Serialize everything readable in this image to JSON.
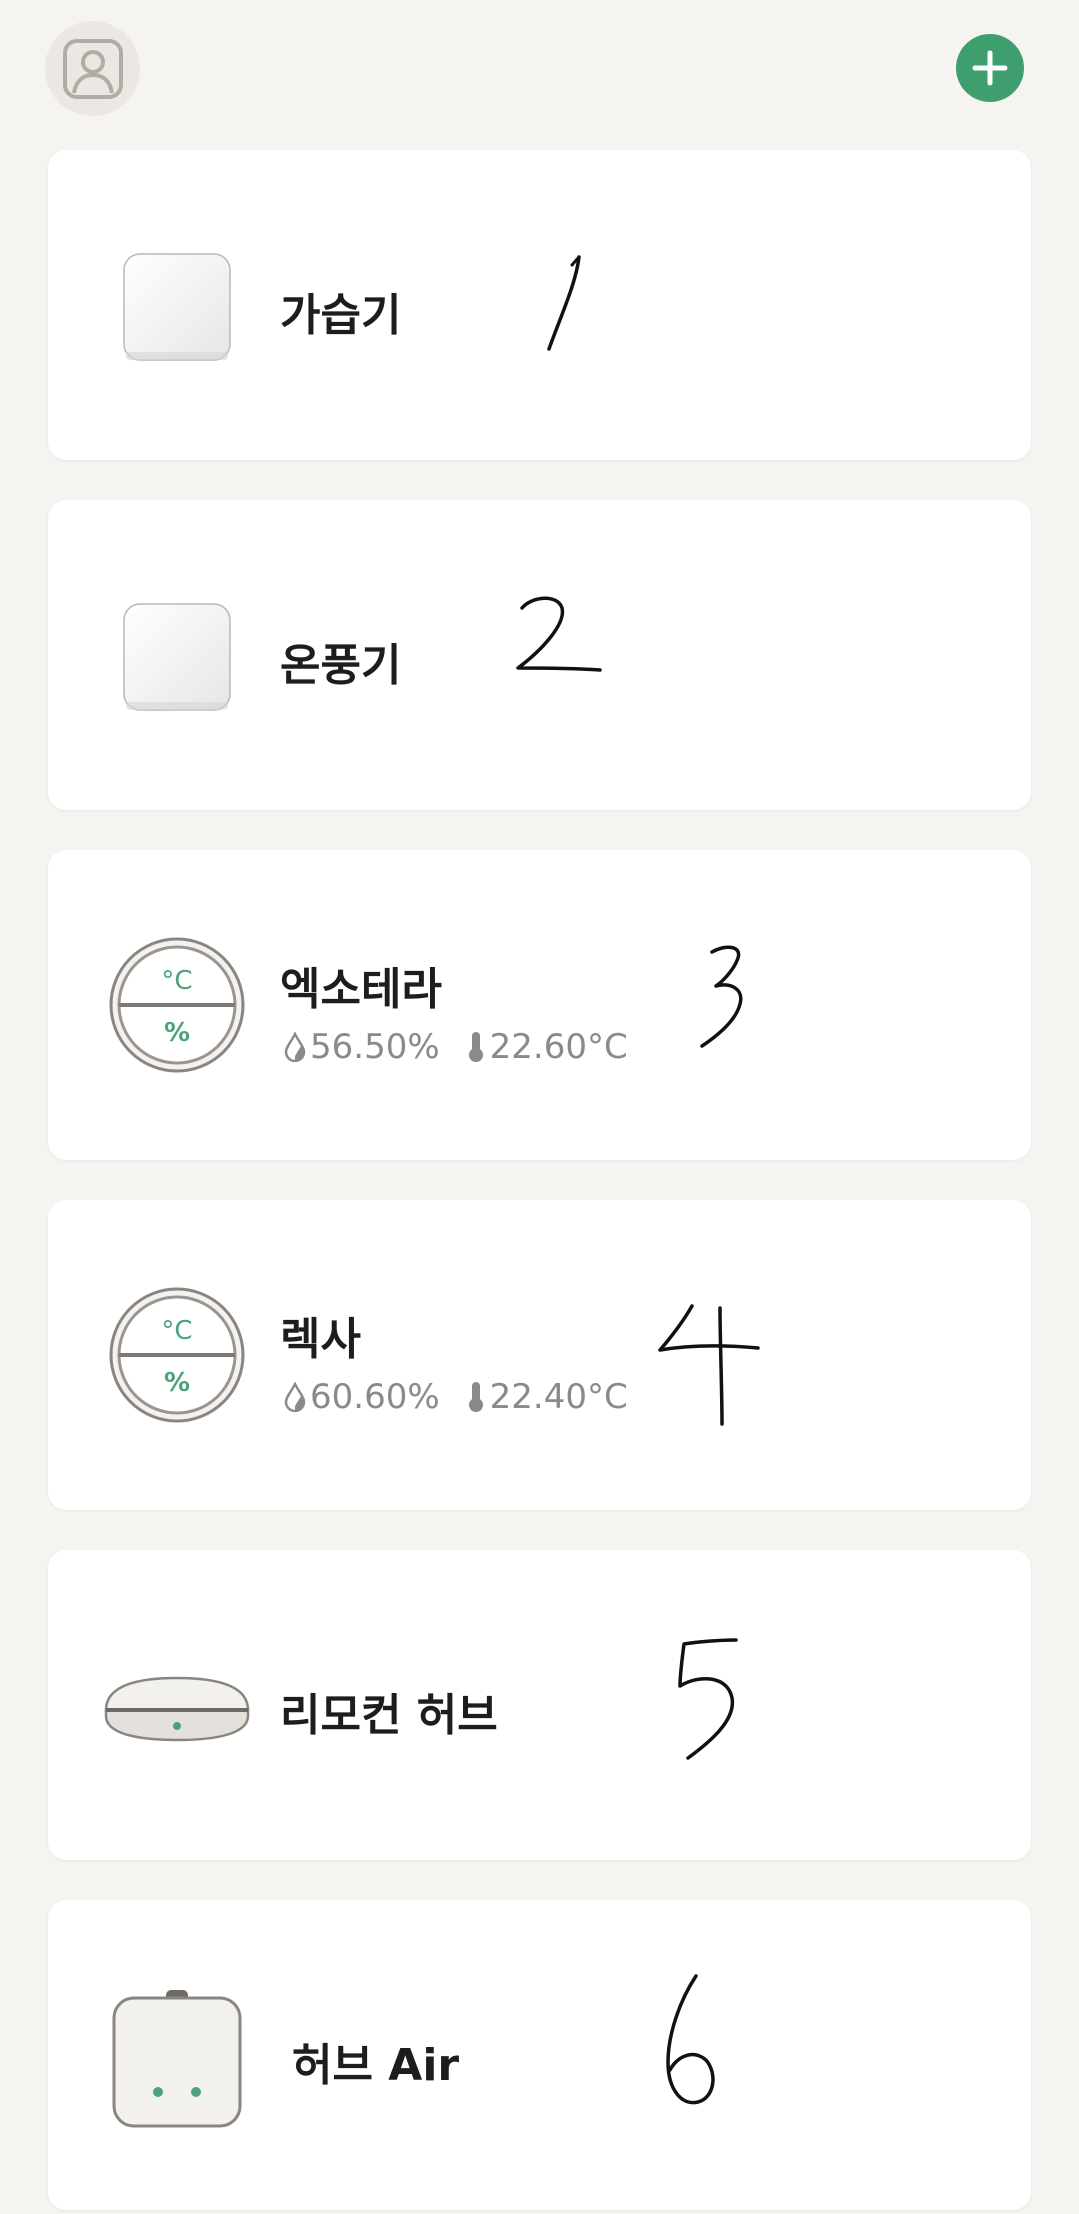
{
  "header": {
    "profile_icon": "person-portrait-icon",
    "add_icon": "plus-icon",
    "accent_color": "#3f9e6e"
  },
  "devices": [
    {
      "name": "가습기",
      "annotation": "1",
      "icon": "square-device-icon"
    },
    {
      "name": "온풍기",
      "annotation": "2",
      "icon": "square-device-icon"
    },
    {
      "name": "엑소테라",
      "annotation": "3",
      "icon": "thermo-hygrometer-icon",
      "humidity": "56.50%",
      "temperature": "22.60°C"
    },
    {
      "name": "렉사",
      "annotation": "4",
      "icon": "thermo-hygrometer-icon",
      "humidity": "60.60%",
      "temperature": "22.40°C"
    },
    {
      "name": "리모컨 허브",
      "annotation": "5",
      "icon": "remote-hub-icon"
    },
    {
      "name": "허브 Air",
      "annotation": "6",
      "icon": "hub-air-icon"
    }
  ],
  "gauge_labels": {
    "celsius": "°C",
    "percent": "%"
  }
}
